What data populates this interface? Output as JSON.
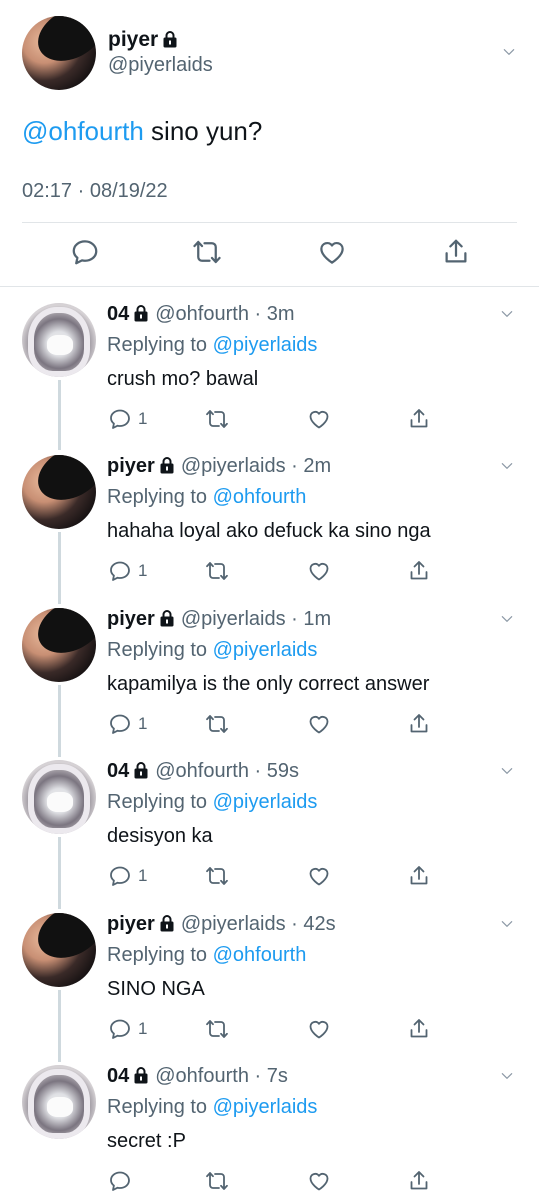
{
  "main_tweet": {
    "name": "piyer",
    "handle": "@piyerlaids",
    "mention": "@ohfourth",
    "text": " sino yun?",
    "timestamp": "02:17 · 08/19/22"
  },
  "replies": [
    {
      "name": "04",
      "handle": "@ohfourth",
      "time": "3m",
      "replying_prefix": "Replying to ",
      "replying_to": "@piyerlaids",
      "text": "crush mo? bawal",
      "reply_count": "1"
    },
    {
      "name": "piyer",
      "handle": "@piyerlaids",
      "time": "2m",
      "replying_prefix": "Replying to ",
      "replying_to": "@ohfourth",
      "text": "hahaha loyal ako defuck ka sino nga",
      "reply_count": "1"
    },
    {
      "name": "piyer",
      "handle": "@piyerlaids",
      "time": "1m",
      "replying_prefix": "Replying to ",
      "replying_to": "@piyerlaids",
      "text": "kapamilya is the only correct answer",
      "reply_count": "1"
    },
    {
      "name": "04",
      "handle": "@ohfourth",
      "time": "59s",
      "replying_prefix": "Replying to ",
      "replying_to": "@piyerlaids",
      "text": "desisyon ka",
      "reply_count": "1"
    },
    {
      "name": "piyer",
      "handle": "@piyerlaids",
      "time": "42s",
      "replying_prefix": "Replying to ",
      "replying_to": "@ohfourth",
      "text": "SINO NGA",
      "reply_count": "1"
    },
    {
      "name": "04",
      "handle": "@ohfourth",
      "time": "7s",
      "replying_prefix": "Replying to ",
      "replying_to": "@piyerlaids",
      "text": "secret :P",
      "reply_count": ""
    }
  ],
  "separator": " · ",
  "colors": {
    "accent": "#1d9bf0",
    "secondary_text": "#536471",
    "icon": "#536471"
  },
  "icons": [
    "lock-icon",
    "chevron-down-icon",
    "reply-icon",
    "retweet-icon",
    "like-icon",
    "share-icon"
  ]
}
